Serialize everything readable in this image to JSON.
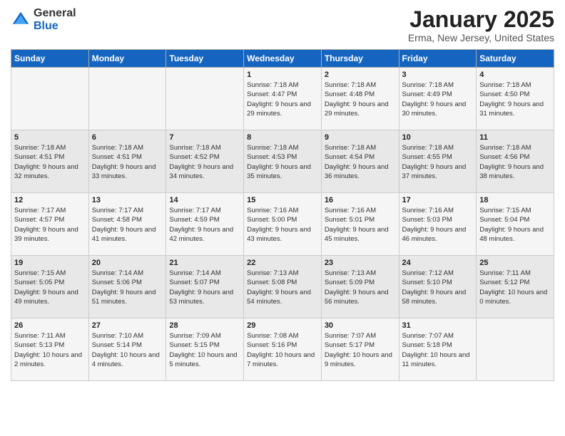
{
  "header": {
    "logo_general": "General",
    "logo_blue": "Blue",
    "month": "January 2025",
    "location": "Erma, New Jersey, United States"
  },
  "days_of_week": [
    "Sunday",
    "Monday",
    "Tuesday",
    "Wednesday",
    "Thursday",
    "Friday",
    "Saturday"
  ],
  "weeks": [
    [
      {
        "day": "",
        "info": ""
      },
      {
        "day": "",
        "info": ""
      },
      {
        "day": "",
        "info": ""
      },
      {
        "day": "1",
        "info": "Sunrise: 7:18 AM\nSunset: 4:47 PM\nDaylight: 9 hours and 29 minutes."
      },
      {
        "day": "2",
        "info": "Sunrise: 7:18 AM\nSunset: 4:48 PM\nDaylight: 9 hours and 29 minutes."
      },
      {
        "day": "3",
        "info": "Sunrise: 7:18 AM\nSunset: 4:49 PM\nDaylight: 9 hours and 30 minutes."
      },
      {
        "day": "4",
        "info": "Sunrise: 7:18 AM\nSunset: 4:50 PM\nDaylight: 9 hours and 31 minutes."
      }
    ],
    [
      {
        "day": "5",
        "info": "Sunrise: 7:18 AM\nSunset: 4:51 PM\nDaylight: 9 hours and 32 minutes."
      },
      {
        "day": "6",
        "info": "Sunrise: 7:18 AM\nSunset: 4:51 PM\nDaylight: 9 hours and 33 minutes."
      },
      {
        "day": "7",
        "info": "Sunrise: 7:18 AM\nSunset: 4:52 PM\nDaylight: 9 hours and 34 minutes."
      },
      {
        "day": "8",
        "info": "Sunrise: 7:18 AM\nSunset: 4:53 PM\nDaylight: 9 hours and 35 minutes."
      },
      {
        "day": "9",
        "info": "Sunrise: 7:18 AM\nSunset: 4:54 PM\nDaylight: 9 hours and 36 minutes."
      },
      {
        "day": "10",
        "info": "Sunrise: 7:18 AM\nSunset: 4:55 PM\nDaylight: 9 hours and 37 minutes."
      },
      {
        "day": "11",
        "info": "Sunrise: 7:18 AM\nSunset: 4:56 PM\nDaylight: 9 hours and 38 minutes."
      }
    ],
    [
      {
        "day": "12",
        "info": "Sunrise: 7:17 AM\nSunset: 4:57 PM\nDaylight: 9 hours and 39 minutes."
      },
      {
        "day": "13",
        "info": "Sunrise: 7:17 AM\nSunset: 4:58 PM\nDaylight: 9 hours and 41 minutes."
      },
      {
        "day": "14",
        "info": "Sunrise: 7:17 AM\nSunset: 4:59 PM\nDaylight: 9 hours and 42 minutes."
      },
      {
        "day": "15",
        "info": "Sunrise: 7:16 AM\nSunset: 5:00 PM\nDaylight: 9 hours and 43 minutes."
      },
      {
        "day": "16",
        "info": "Sunrise: 7:16 AM\nSunset: 5:01 PM\nDaylight: 9 hours and 45 minutes."
      },
      {
        "day": "17",
        "info": "Sunrise: 7:16 AM\nSunset: 5:03 PM\nDaylight: 9 hours and 46 minutes."
      },
      {
        "day": "18",
        "info": "Sunrise: 7:15 AM\nSunset: 5:04 PM\nDaylight: 9 hours and 48 minutes."
      }
    ],
    [
      {
        "day": "19",
        "info": "Sunrise: 7:15 AM\nSunset: 5:05 PM\nDaylight: 9 hours and 49 minutes."
      },
      {
        "day": "20",
        "info": "Sunrise: 7:14 AM\nSunset: 5:06 PM\nDaylight: 9 hours and 51 minutes."
      },
      {
        "day": "21",
        "info": "Sunrise: 7:14 AM\nSunset: 5:07 PM\nDaylight: 9 hours and 53 minutes."
      },
      {
        "day": "22",
        "info": "Sunrise: 7:13 AM\nSunset: 5:08 PM\nDaylight: 9 hours and 54 minutes."
      },
      {
        "day": "23",
        "info": "Sunrise: 7:13 AM\nSunset: 5:09 PM\nDaylight: 9 hours and 56 minutes."
      },
      {
        "day": "24",
        "info": "Sunrise: 7:12 AM\nSunset: 5:10 PM\nDaylight: 9 hours and 58 minutes."
      },
      {
        "day": "25",
        "info": "Sunrise: 7:11 AM\nSunset: 5:12 PM\nDaylight: 10 hours and 0 minutes."
      }
    ],
    [
      {
        "day": "26",
        "info": "Sunrise: 7:11 AM\nSunset: 5:13 PM\nDaylight: 10 hours and 2 minutes."
      },
      {
        "day": "27",
        "info": "Sunrise: 7:10 AM\nSunset: 5:14 PM\nDaylight: 10 hours and 4 minutes."
      },
      {
        "day": "28",
        "info": "Sunrise: 7:09 AM\nSunset: 5:15 PM\nDaylight: 10 hours and 5 minutes."
      },
      {
        "day": "29",
        "info": "Sunrise: 7:08 AM\nSunset: 5:16 PM\nDaylight: 10 hours and 7 minutes."
      },
      {
        "day": "30",
        "info": "Sunrise: 7:07 AM\nSunset: 5:17 PM\nDaylight: 10 hours and 9 minutes."
      },
      {
        "day": "31",
        "info": "Sunrise: 7:07 AM\nSunset: 5:18 PM\nDaylight: 10 hours and 11 minutes."
      },
      {
        "day": "",
        "info": ""
      }
    ]
  ]
}
